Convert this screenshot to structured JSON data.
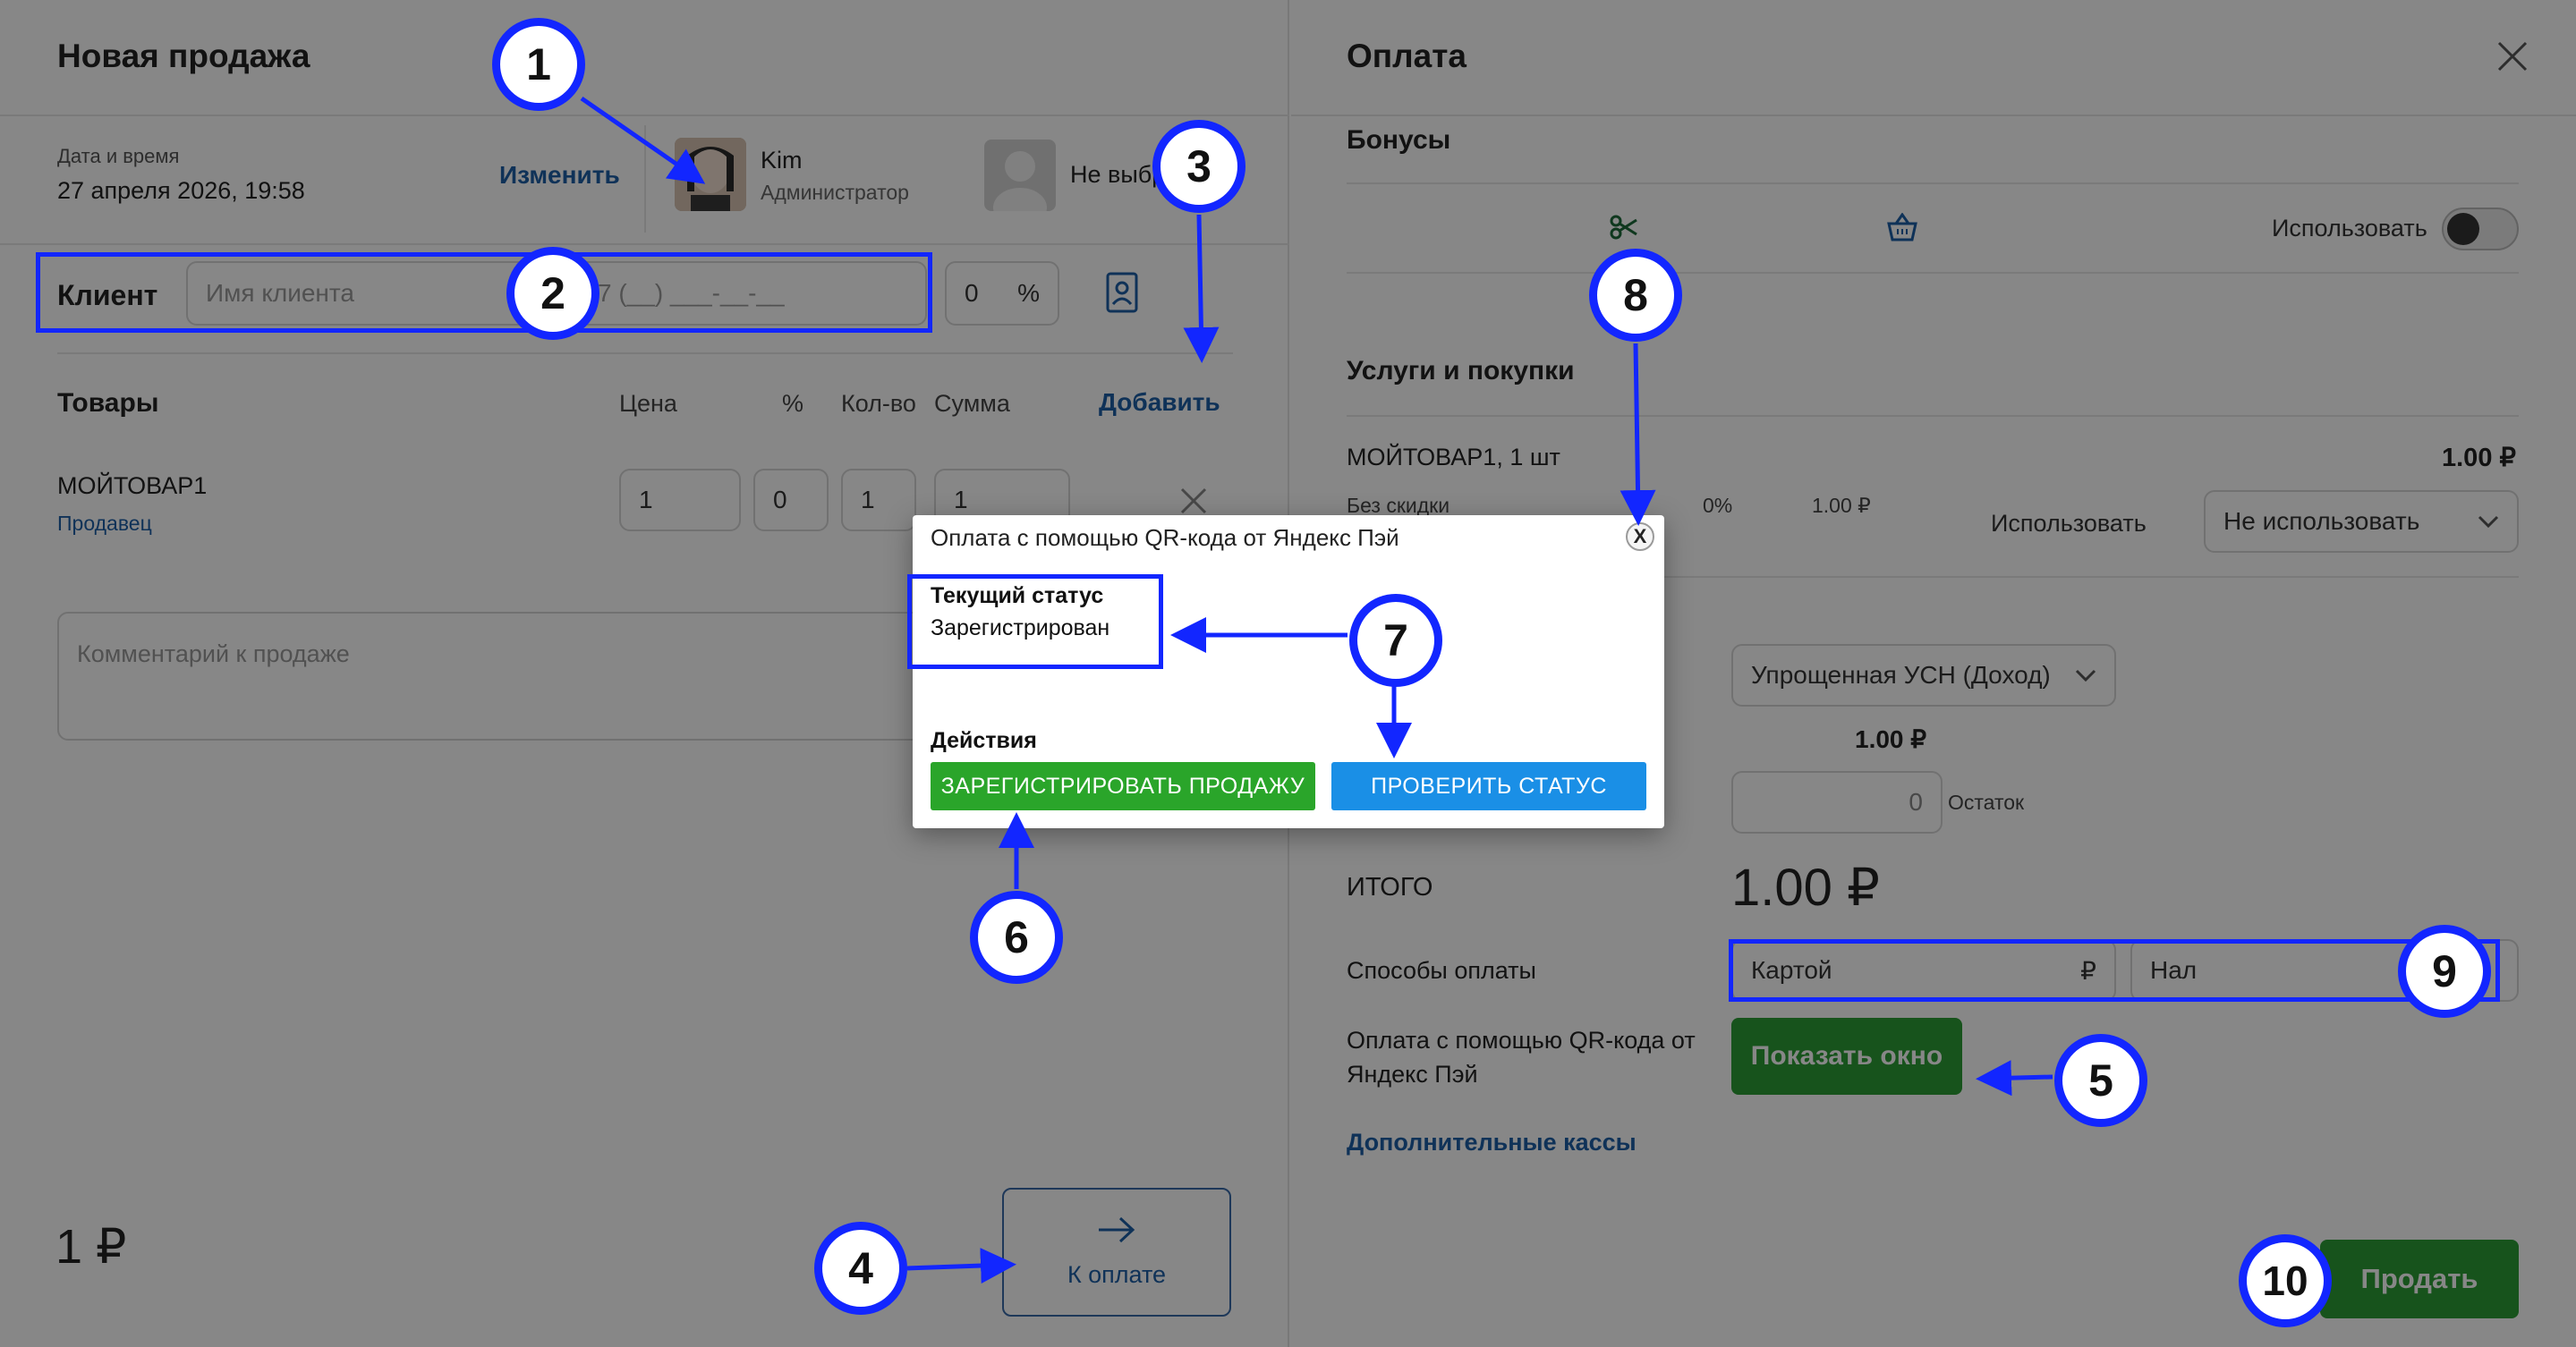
{
  "left": {
    "title": "Новая продажа",
    "datetime_label": "Дата и время",
    "datetime_value": "27 апреля 2026, 19:58",
    "change_link": "Изменить",
    "employee_name": "Kim",
    "employee_role": "Администратор",
    "not_selected": "Не выбр",
    "client_label": "Клиент",
    "client_name_placeholder": "Имя клиента",
    "phone_placeholder": "7 (__) ___-__-__",
    "discount_value": "0",
    "discount_unit": "%",
    "goods_label": "Товары",
    "col_price": "Цена",
    "col_percent": "%",
    "col_qty": "Кол-во",
    "col_sum": "Сумма",
    "add_link": "Добавить",
    "item_name": "МОЙТОВАР1",
    "item_seller": "Продавец",
    "item_price": "1",
    "item_percent": "0",
    "item_qty": "1",
    "item_sum": "1",
    "comment_placeholder": "Комментарий к продаже",
    "total": "1 ₽",
    "to_payment": "К оплате"
  },
  "right": {
    "title": "Оплата",
    "bonuses": "Бонусы",
    "use_label": "Использовать",
    "services_label": "Услуги и покупки",
    "service_item": "МОЙТОВАР1, 1 шт",
    "service_price": "1.00 ₽",
    "no_discount": "Без скидки",
    "discount_pct": "0%",
    "discount_sum": "1.00 ₽",
    "use_label2": "Использовать",
    "not_use": "Не использовать",
    "tax_system": "Упрощенная УСН (Доход)",
    "tax_amount": "1.00 ₽",
    "remainder_value": "0",
    "remainder_label": "Остаток",
    "itogo_label": "ИТОГО",
    "itogo_value": "1.00 ₽",
    "payment_methods": "Способы оплаты",
    "by_card": "Картой",
    "card_currency": "₽",
    "cash": "Нал",
    "qr_label": "Оплата с помощью QR-кода от Яндекс Пэй",
    "show_window": "Показать окно",
    "extra_cashboxes": "Дополнительные кассы",
    "sell": "Продать"
  },
  "modal": {
    "title": "Оплата с помощью QR-кода от Яндекс Пэй",
    "close": "X",
    "status_label": "Текущий статус",
    "status_value": "Зарегистрирован",
    "actions_label": "Действия",
    "register_btn": "ЗАРЕГИСТРИРОВАТЬ ПРОДАЖУ",
    "check_btn": "ПРОВЕРИТЬ СТАТУС"
  },
  "annotations": [
    "1",
    "2",
    "3",
    "4",
    "5",
    "6",
    "7",
    "8",
    "9",
    "10"
  ],
  "colors": {
    "annotation_blue": "#1226ff",
    "green_button": "#2aa52a",
    "blue_button": "#1a8fe6",
    "link_blue": "#1e5fa6",
    "sell_green": "#2d9e36"
  }
}
